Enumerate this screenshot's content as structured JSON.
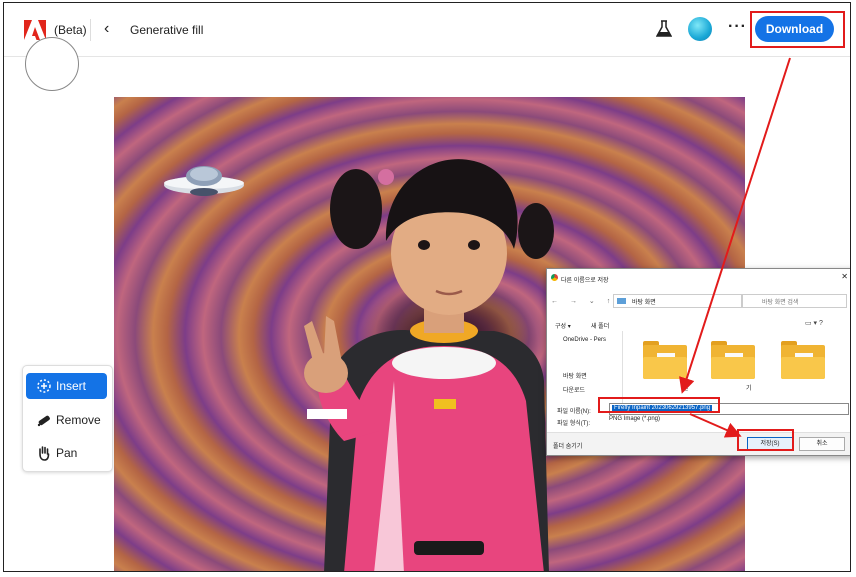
{
  "header": {
    "beta_label": "(Beta)",
    "back_glyph": "‹",
    "title": "Generative fill",
    "more_glyph": "···",
    "download_label": "Download"
  },
  "tools": [
    {
      "label": "Insert",
      "icon": "insert-icon",
      "active": true
    },
    {
      "label": "Remove",
      "icon": "remove-icon",
      "active": false
    },
    {
      "label": "Pan",
      "icon": "hand-icon",
      "active": false
    }
  ],
  "dialog": {
    "title": "다른 이름으로 저장",
    "address": "바탕 화면",
    "search_placeholder": "바탕 화면 검색",
    "organize": "구성 ▾",
    "new_folder": "새 폴더",
    "tree": [
      "OneDrive - Pers",
      "바탕 화면",
      "다운로드"
    ],
    "folders": [
      {
        "label": ""
      },
      {
        "label": "한"
      },
      {
        "label": "기"
      }
    ],
    "filename_label": "파일 이름(N):",
    "filename": "Firefly Inpaint 20230629213957.png",
    "filetype_label": "파일 형식(T):",
    "filetype": "PNG Image (*.png)",
    "hide_folders": "폴더 숨기기",
    "save_label": "저장(S)",
    "cancel_label": "취소"
  },
  "colors": {
    "accent": "#1473e6",
    "annotation": "#e21b1b"
  }
}
